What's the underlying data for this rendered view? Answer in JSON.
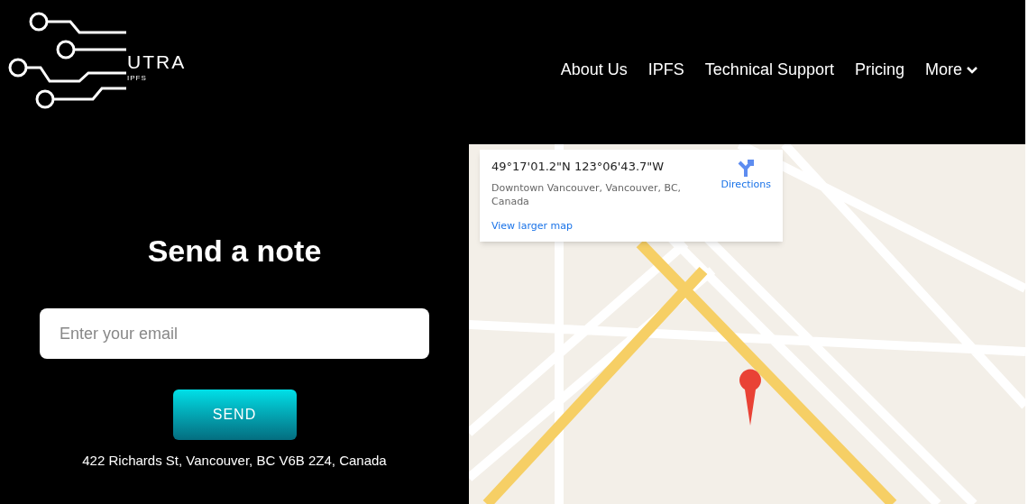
{
  "logo": {
    "name": "UTRA",
    "sub": "IPFS"
  },
  "nav": [
    {
      "label": "About Us",
      "kind": "link"
    },
    {
      "label": "IPFS",
      "kind": "link"
    },
    {
      "label": "Technical Support",
      "kind": "link"
    },
    {
      "label": "Pricing",
      "kind": "link"
    },
    {
      "label": "More",
      "kind": "dropdown"
    }
  ],
  "form": {
    "title": "Send a note",
    "email_placeholder": "Enter your email",
    "button": "SEND",
    "address": "422 Richards St, Vancouver, BC V6B 2Z4, Canada"
  },
  "map_card": {
    "coordinates": "49°17'01.2\"N 123°06'43.7\"W",
    "place": "Downtown Vancouver, Vancouver, BC, Canada",
    "directions": "Directions",
    "larger_map": "View larger map"
  }
}
